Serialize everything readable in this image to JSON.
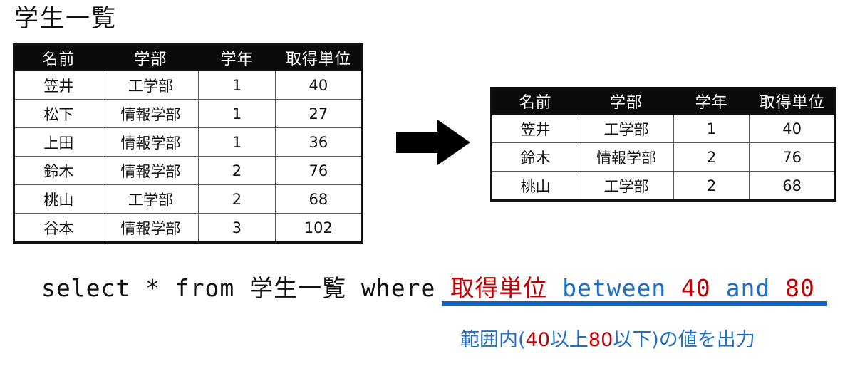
{
  "title": "学生一覧",
  "source_table": {
    "name": "学生一覧",
    "columns": [
      "名前",
      "学部",
      "学年",
      "取得単位"
    ],
    "rows": [
      {
        "name": "笠井",
        "dept": "工学部",
        "year": "1",
        "credits": "40",
        "highlight": true
      },
      {
        "name": "松下",
        "dept": "情報学部",
        "year": "1",
        "credits": "27",
        "highlight": false
      },
      {
        "name": "上田",
        "dept": "情報学部",
        "year": "1",
        "credits": "36",
        "highlight": false
      },
      {
        "name": "鈴木",
        "dept": "情報学部",
        "year": "2",
        "credits": "76",
        "highlight": true
      },
      {
        "name": "桃山",
        "dept": "工学部",
        "year": "2",
        "credits": "68",
        "highlight": true
      },
      {
        "name": "谷本",
        "dept": "情報学部",
        "year": "3",
        "credits": "102",
        "highlight": false
      }
    ]
  },
  "result_table": {
    "columns": [
      "名前",
      "学部",
      "学年",
      "取得単位"
    ],
    "rows": [
      {
        "name": "笠井",
        "dept": "工学部",
        "year": "1",
        "credits": "40",
        "highlight": true
      },
      {
        "name": "鈴木",
        "dept": "情報学部",
        "year": "2",
        "credits": "76",
        "highlight": true
      },
      {
        "name": "桃山",
        "dept": "工学部",
        "year": "2",
        "credits": "68",
        "highlight": true
      }
    ]
  },
  "arrow": {
    "direction": "right",
    "color": "#000000"
  },
  "sql": {
    "full": "select * from 学生一覧 where 取得単位 between 40 and 80",
    "segments": [
      {
        "text": "select * from 学生一覧 where ",
        "color": "black"
      },
      {
        "text": "取得単位",
        "color": "red"
      },
      {
        "text": " between ",
        "color": "blue"
      },
      {
        "text": "40",
        "color": "red"
      },
      {
        "text": " and ",
        "color": "blue"
      },
      {
        "text": "80",
        "color": "red"
      }
    ],
    "underline_color": "#1565C0"
  },
  "annotation": {
    "prefix": "範囲内(",
    "low": "40",
    "middle": "以上",
    "high": "80",
    "suffix": "以下)の値を出力",
    "full": "範囲内(40以上80以下)の値を出力",
    "color": "#1F6FC4",
    "accent_color": "#C00000"
  },
  "colors": {
    "highlight_red": "#C00000",
    "accent_blue": "#1F6FC4",
    "underline_blue": "#1565C0",
    "header_bg": "#0B0B0B",
    "text": "#111111"
  }
}
